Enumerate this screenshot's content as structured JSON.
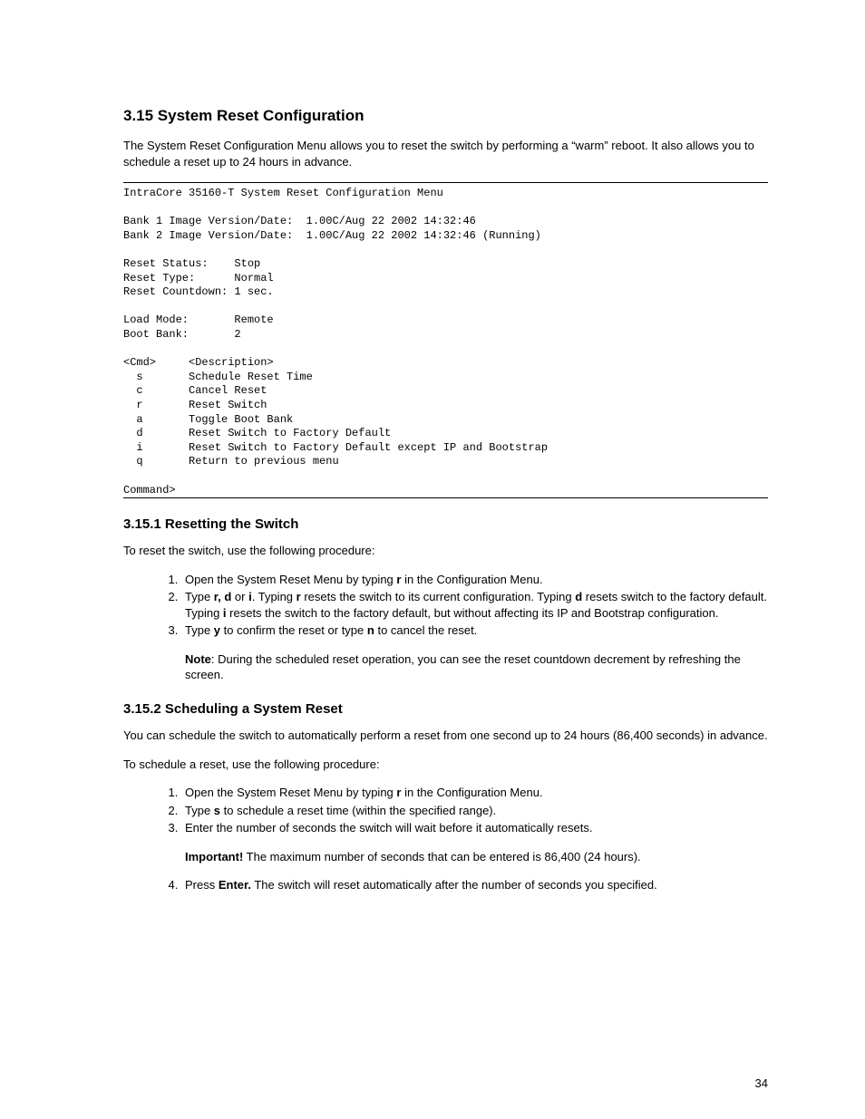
{
  "headings": {
    "h_3_15": "3.15 System Reset Configuration",
    "h_3_15_1": "3.15.1 Resetting the Switch",
    "h_3_15_2": "3.15.2 Scheduling a System Reset"
  },
  "paras": {
    "p1": "The System Reset Configuration Menu allows you to reset the switch by performing a “warm” reboot. It also allows you to schedule a reset up to 24 hours in advance.",
    "p2": "To reset the switch, use the following procedure:",
    "p3": "You can schedule the switch to automatically perform a reset from one second up to 24 hours (86,400 seconds) in advance.",
    "p4": "To schedule a reset, use the following procedure:"
  },
  "terminal": {
    "title": "IntraCore 35160-T System Reset Configuration Menu",
    "bank1": "Bank 1 Image Version/Date:  1.00C/Aug 22 2002 14:32:46",
    "bank2": "Bank 2 Image Version/Date:  1.00C/Aug 22 2002 14:32:46 (Running)",
    "reset_status": "Reset Status:    Stop",
    "reset_type": "Reset Type:      Normal",
    "reset_count": "Reset Countdown: 1 sec.",
    "load_mode": "Load Mode:       Remote",
    "boot_bank": "Boot Bank:       2",
    "cmd_header": "<Cmd>     <Description>",
    "cmd_s": "  s       Schedule Reset Time",
    "cmd_c": "  c       Cancel Reset",
    "cmd_r": "  r       Reset Switch",
    "cmd_a": "  a       Toggle Boot Bank",
    "cmd_d": "  d       Reset Switch to Factory Default",
    "cmd_i": "  i       Reset Switch to Factory Default except IP and Bootstrap",
    "cmd_q": "  q       Return to previous menu",
    "prompt": "Command>"
  },
  "list1": {
    "i1_a": "Open the System Reset Menu by typing ",
    "i1_b": "r",
    "i1_c": " in the Configuration Menu.",
    "i2_a": "Type ",
    "i2_b": "r, d",
    "i2_c": " or ",
    "i2_d": "i",
    "i2_e": ". Typing ",
    "i2_f": "r",
    "i2_g": " resets the switch to its current configuration. Typing ",
    "i2_h": "d",
    "i2_i": " resets switch to the factory default. Typing ",
    "i2_j": "i",
    "i2_k": " resets the switch to the factory default, but without affecting its IP and Bootstrap configuration.",
    "i3_a": "Type ",
    "i3_b": "y",
    "i3_c": " to confirm the reset or type ",
    "i3_d": "n",
    "i3_e": " to cancel the reset.",
    "note_a": "Note",
    "note_b": ": During the scheduled reset operation, you can see the reset countdown decrement by refreshing the screen."
  },
  "list2": {
    "i1_a": "Open the System Reset Menu by typing ",
    "i1_b": "r",
    "i1_c": " in the Configuration Menu.",
    "i2_a": "Type ",
    "i2_b": "s",
    "i2_c": " to schedule a reset time (within the specified range).",
    "i3": "Enter the number of seconds the switch will wait before it automatically resets.",
    "imp_a": "Important!",
    "imp_b": " The maximum number of seconds that can be entered is 86,400 (24 hours).",
    "i4_a": "Press ",
    "i4_b": "Enter.",
    "i4_c": " The switch will reset automatically after the number of seconds you specified."
  },
  "page_number": "34"
}
